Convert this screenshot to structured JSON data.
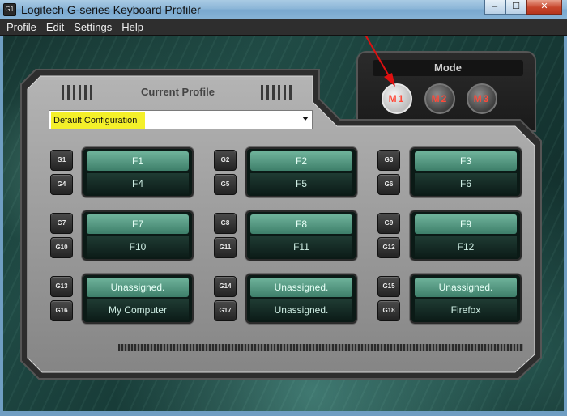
{
  "window": {
    "title": "Logitech G-series Keyboard Profiler",
    "icon_label": "G1",
    "controls": {
      "minimize": "–",
      "maximize": "☐",
      "close": "✕"
    }
  },
  "menu": [
    "Profile",
    "Edit",
    "Settings",
    "Help"
  ],
  "mode": {
    "label": "Mode",
    "buttons": [
      "M1",
      "M2",
      "M3"
    ],
    "active": "M1"
  },
  "profile": {
    "label": "Current Profile",
    "selected": "Default Configuration",
    "highlight_color": "#f4f02a"
  },
  "groups": [
    {
      "keys": [
        "G1",
        "G4"
      ],
      "top": "F1",
      "bottom": "F4"
    },
    {
      "keys": [
        "G2",
        "G5"
      ],
      "top": "F2",
      "bottom": "F5"
    },
    {
      "keys": [
        "G3",
        "G6"
      ],
      "top": "F3",
      "bottom": "F6"
    },
    {
      "keys": [
        "G7",
        "G10"
      ],
      "top": "F7",
      "bottom": "F10"
    },
    {
      "keys": [
        "G8",
        "G11"
      ],
      "top": "F8",
      "bottom": "F11"
    },
    {
      "keys": [
        "G9",
        "G12"
      ],
      "top": "F9",
      "bottom": "F12"
    },
    {
      "keys": [
        "G13",
        "G16"
      ],
      "top": "Unassigned.",
      "bottom": "My Computer"
    },
    {
      "keys": [
        "G14",
        "G17"
      ],
      "top": "Unassigned.",
      "bottom": "Unassigned."
    },
    {
      "keys": [
        "G15",
        "G18"
      ],
      "top": "Unassigned.",
      "bottom": "Firefox"
    }
  ],
  "annotation": {
    "arrow_color": "#e01010"
  }
}
